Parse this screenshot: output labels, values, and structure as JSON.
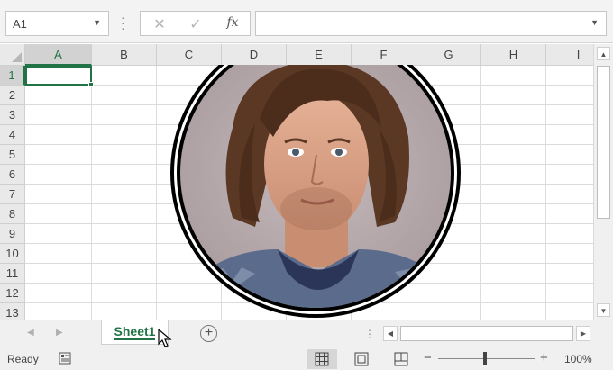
{
  "formula_bar": {
    "name_box": "A1",
    "cancel_glyph": "✕",
    "enter_glyph": "✓",
    "function_label": "fx",
    "formula_value": ""
  },
  "columns": [
    "A",
    "B",
    "C",
    "D",
    "E",
    "F",
    "G",
    "H",
    "I"
  ],
  "rows": [
    "1",
    "2",
    "3",
    "4",
    "5",
    "6",
    "7",
    "8",
    "9",
    "10",
    "11",
    "12",
    "13"
  ],
  "selected_cell": "A1",
  "image": {
    "description_icon": "portrait-photo",
    "frame_style": "circle-double-black-border"
  },
  "sheets": {
    "tabs": [
      {
        "label": "Sheet1",
        "active": true
      }
    ],
    "add_icon": "plus-circle-icon"
  },
  "status": {
    "ready_text": "Ready",
    "zoom_level": "100%",
    "zoom_fraction": 0.5
  },
  "colors": {
    "accent": "#217346",
    "header_bg": "#e9e9e9",
    "grid_line": "#dcdcdc"
  }
}
